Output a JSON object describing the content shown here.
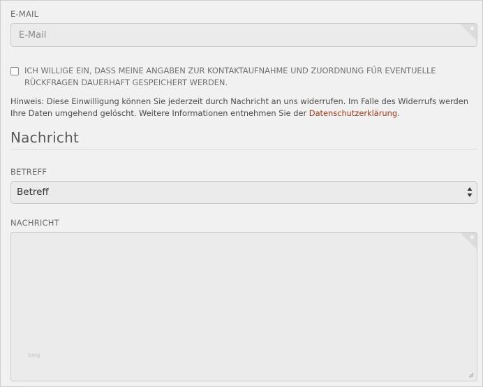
{
  "email": {
    "label": "E-MAIL",
    "placeholder": "E-Mail",
    "value": ""
  },
  "consent": {
    "checked": false,
    "text": "ICH WILLIGE EIN, DASS MEINE ANGABEN ZUR KONTAKTAUFNAHME UND ZUORDNUNG FÜR EVENTUELLE RÜCKFRAGEN DAUERHAFT GESPEICHERT WERDEN."
  },
  "hint": {
    "text_before": "Hinweis: Diese Einwilligung können Sie jederzeit durch Nachricht an uns widerrufen. Im Falle des Widerrufs werden Ihre Daten umgehend gelöscht. Weitere Informationen entnehmen Sie der ",
    "link_label": "Datenschutzerklärung",
    "text_after": ".",
    "link_color": "#a33a1c"
  },
  "message_section": {
    "title": "Nachricht"
  },
  "subject": {
    "label": "BETREFF",
    "selected": "Betreff"
  },
  "message": {
    "label": "NACHRICHT",
    "value": "",
    "watermark": "blog"
  },
  "icons": {
    "select": "updown-arrows-icon",
    "resize": "resize-grip-icon",
    "checkbox": "checkbox-unchecked-icon"
  }
}
